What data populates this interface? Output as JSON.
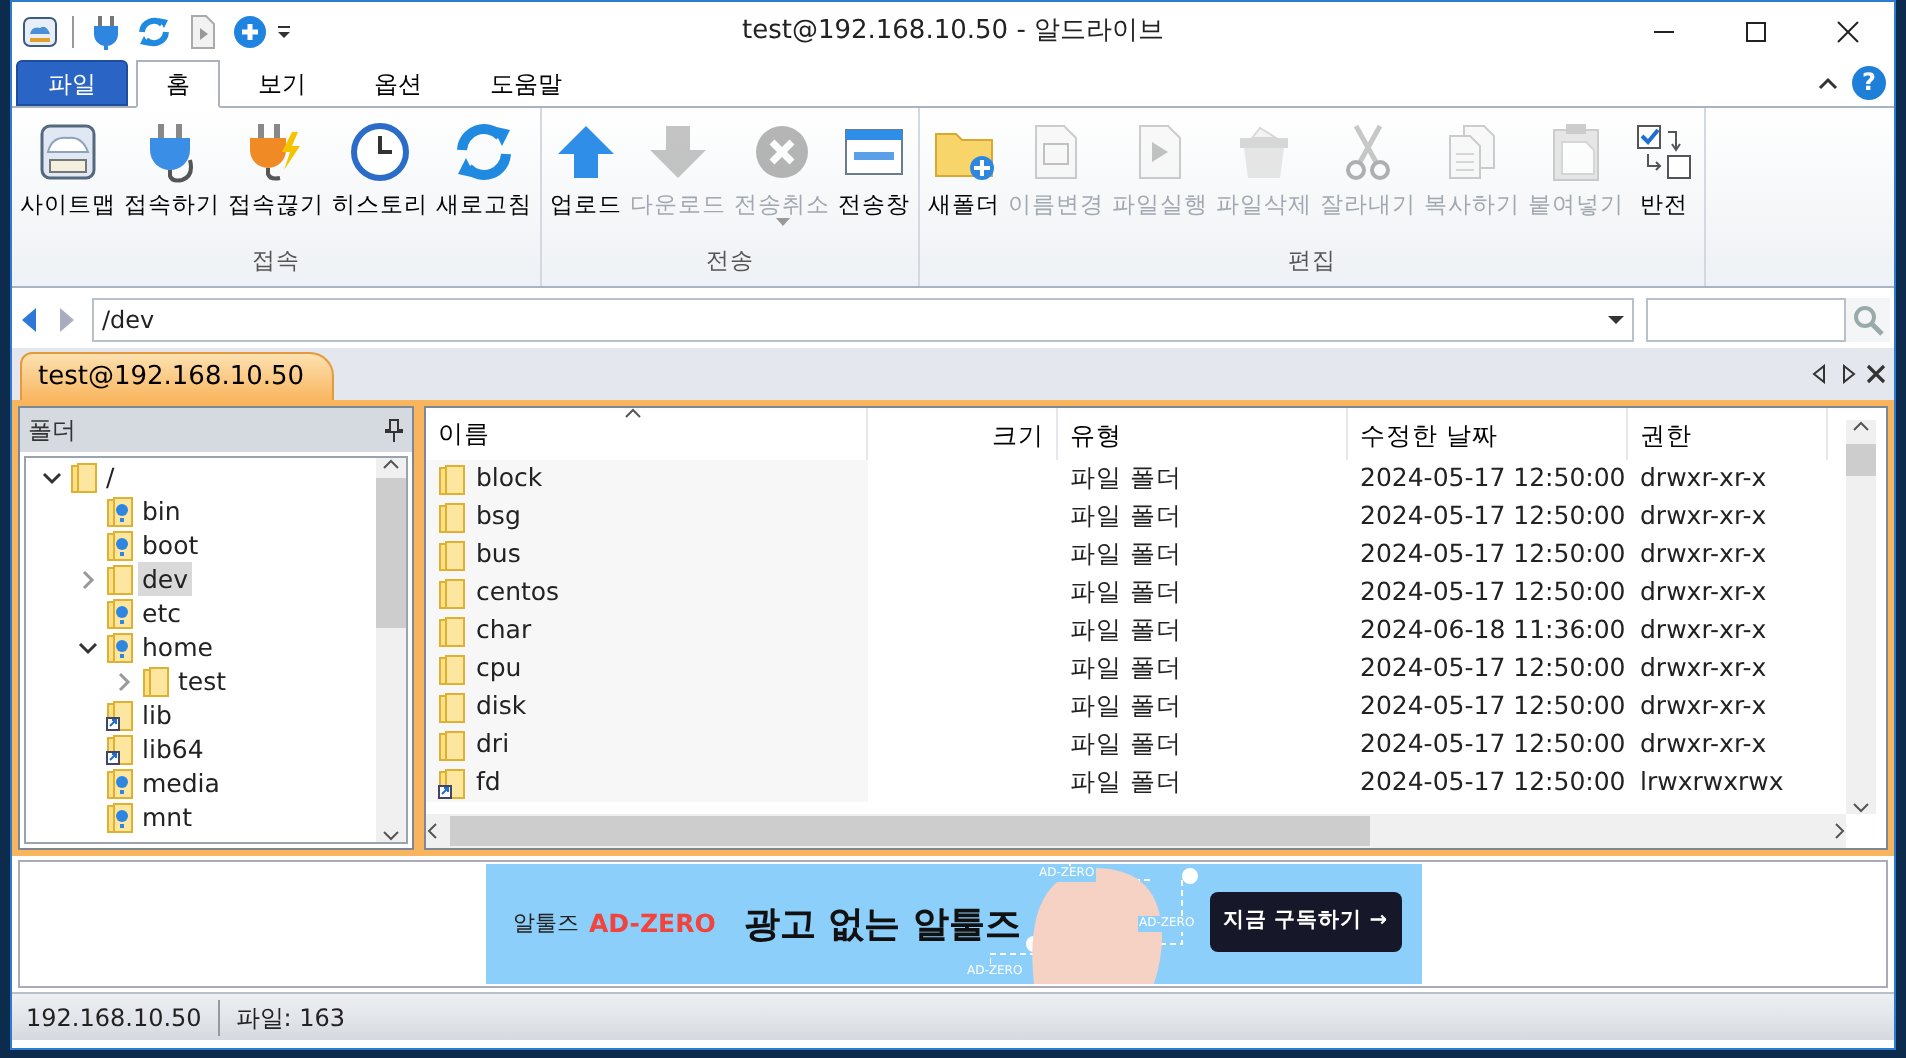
{
  "window": {
    "title": "test@192.168.10.50 - 알드라이브"
  },
  "ribbon": {
    "file_tab": "파일",
    "help": "?",
    "tabs": [
      {
        "label": "홈",
        "selected": true
      },
      {
        "label": "보기",
        "selected": false
      },
      {
        "label": "옵션",
        "selected": false
      },
      {
        "label": "도움말",
        "selected": false
      }
    ],
    "groups": [
      {
        "label": "접속",
        "buttons": [
          {
            "label": "사이트맵",
            "disabled": false,
            "dropdown": false
          },
          {
            "label": "접속하기",
            "disabled": false,
            "dropdown": false
          },
          {
            "label": "접속끊기",
            "disabled": false,
            "dropdown": false
          },
          {
            "label": "히스토리",
            "disabled": false,
            "dropdown": false
          },
          {
            "label": "새로고침",
            "disabled": false,
            "dropdown": false
          }
        ]
      },
      {
        "label": "전송",
        "buttons": [
          {
            "label": "업로드",
            "disabled": false,
            "dropdown": false
          },
          {
            "label": "다운로드",
            "disabled": true,
            "dropdown": false
          },
          {
            "label": "전송취소",
            "disabled": true,
            "dropdown": true
          },
          {
            "label": "전송창",
            "disabled": false,
            "dropdown": false
          }
        ]
      },
      {
        "label": "편집",
        "buttons": [
          {
            "label": "새폴더",
            "disabled": false,
            "dropdown": false
          },
          {
            "label": "이름변경",
            "disabled": true,
            "dropdown": false
          },
          {
            "label": "파일실행",
            "disabled": true,
            "dropdown": false
          },
          {
            "label": "파일삭제",
            "disabled": true,
            "dropdown": false
          },
          {
            "label": "잘라내기",
            "disabled": true,
            "dropdown": false
          },
          {
            "label": "복사하기",
            "disabled": true,
            "dropdown": false
          },
          {
            "label": "붙여넣기",
            "disabled": true,
            "dropdown": false
          },
          {
            "label": "반전",
            "disabled": false,
            "dropdown": false
          }
        ]
      }
    ]
  },
  "address_bar": {
    "path": "/dev"
  },
  "session_tab": {
    "label": "test@192.168.10.50"
  },
  "folder_pane": {
    "title": "폴더",
    "tree": [
      {
        "label": "/",
        "kind": "folder",
        "expanded": true,
        "selected": false,
        "children": [
          {
            "label": "bin",
            "kind": "unknown",
            "selected": false
          },
          {
            "label": "boot",
            "kind": "unknown",
            "selected": false
          },
          {
            "label": "dev",
            "kind": "folder",
            "expanded": false,
            "selected": true
          },
          {
            "label": "etc",
            "kind": "unknown",
            "selected": false
          },
          {
            "label": "home",
            "kind": "unknown",
            "expanded": true,
            "selected": false,
            "children": [
              {
                "label": "test",
                "kind": "folder",
                "expanded": false,
                "selected": false
              }
            ]
          },
          {
            "label": "lib",
            "kind": "link",
            "selected": false
          },
          {
            "label": "lib64",
            "kind": "link",
            "selected": false
          },
          {
            "label": "media",
            "kind": "unknown",
            "selected": false
          },
          {
            "label": "mnt",
            "kind": "unknown",
            "selected": false
          }
        ]
      }
    ]
  },
  "file_list": {
    "columns": [
      {
        "label": "이름",
        "sorted": true
      },
      {
        "label": "크기",
        "sorted": false
      },
      {
        "label": "유형",
        "sorted": false
      },
      {
        "label": "수정한 날짜",
        "sorted": false
      },
      {
        "label": "권한",
        "sorted": false
      }
    ],
    "rows": [
      {
        "name": "block",
        "kind": "folder",
        "type": "파일 폴더",
        "modified": "2024-05-17 12:50:00",
        "permissions": "drwxr-xr-x"
      },
      {
        "name": "bsg",
        "kind": "folder",
        "type": "파일 폴더",
        "modified": "2024-05-17 12:50:00",
        "permissions": "drwxr-xr-x"
      },
      {
        "name": "bus",
        "kind": "folder",
        "type": "파일 폴더",
        "modified": "2024-05-17 12:50:00",
        "permissions": "drwxr-xr-x"
      },
      {
        "name": "centos",
        "kind": "folder",
        "type": "파일 폴더",
        "modified": "2024-05-17 12:50:00",
        "permissions": "drwxr-xr-x"
      },
      {
        "name": "char",
        "kind": "folder",
        "type": "파일 폴더",
        "modified": "2024-06-18 11:36:00",
        "permissions": "drwxr-xr-x"
      },
      {
        "name": "cpu",
        "kind": "folder",
        "type": "파일 폴더",
        "modified": "2024-05-17 12:50:00",
        "permissions": "drwxr-xr-x"
      },
      {
        "name": "disk",
        "kind": "folder",
        "type": "파일 폴더",
        "modified": "2024-05-17 12:50:00",
        "permissions": "drwxr-xr-x"
      },
      {
        "name": "dri",
        "kind": "folder",
        "type": "파일 폴더",
        "modified": "2024-05-17 12:50:00",
        "permissions": "drwxr-xr-x"
      },
      {
        "name": "fd",
        "kind": "link",
        "type": "파일 폴더",
        "modified": "2024-05-17 12:50:00",
        "permissions": "lrwxrwxrwx"
      }
    ]
  },
  "ad": {
    "brand": "알툴즈",
    "product": "AD-ZERO",
    "headline": "광고 없는 알툴즈",
    "button": "지금 구독하기 →",
    "tags": [
      "AD-ZERO",
      "AD-ZERO",
      "AD-ZERO"
    ]
  },
  "status_bar": {
    "host": "192.168.10.50",
    "file_count": "파일: 163"
  }
}
